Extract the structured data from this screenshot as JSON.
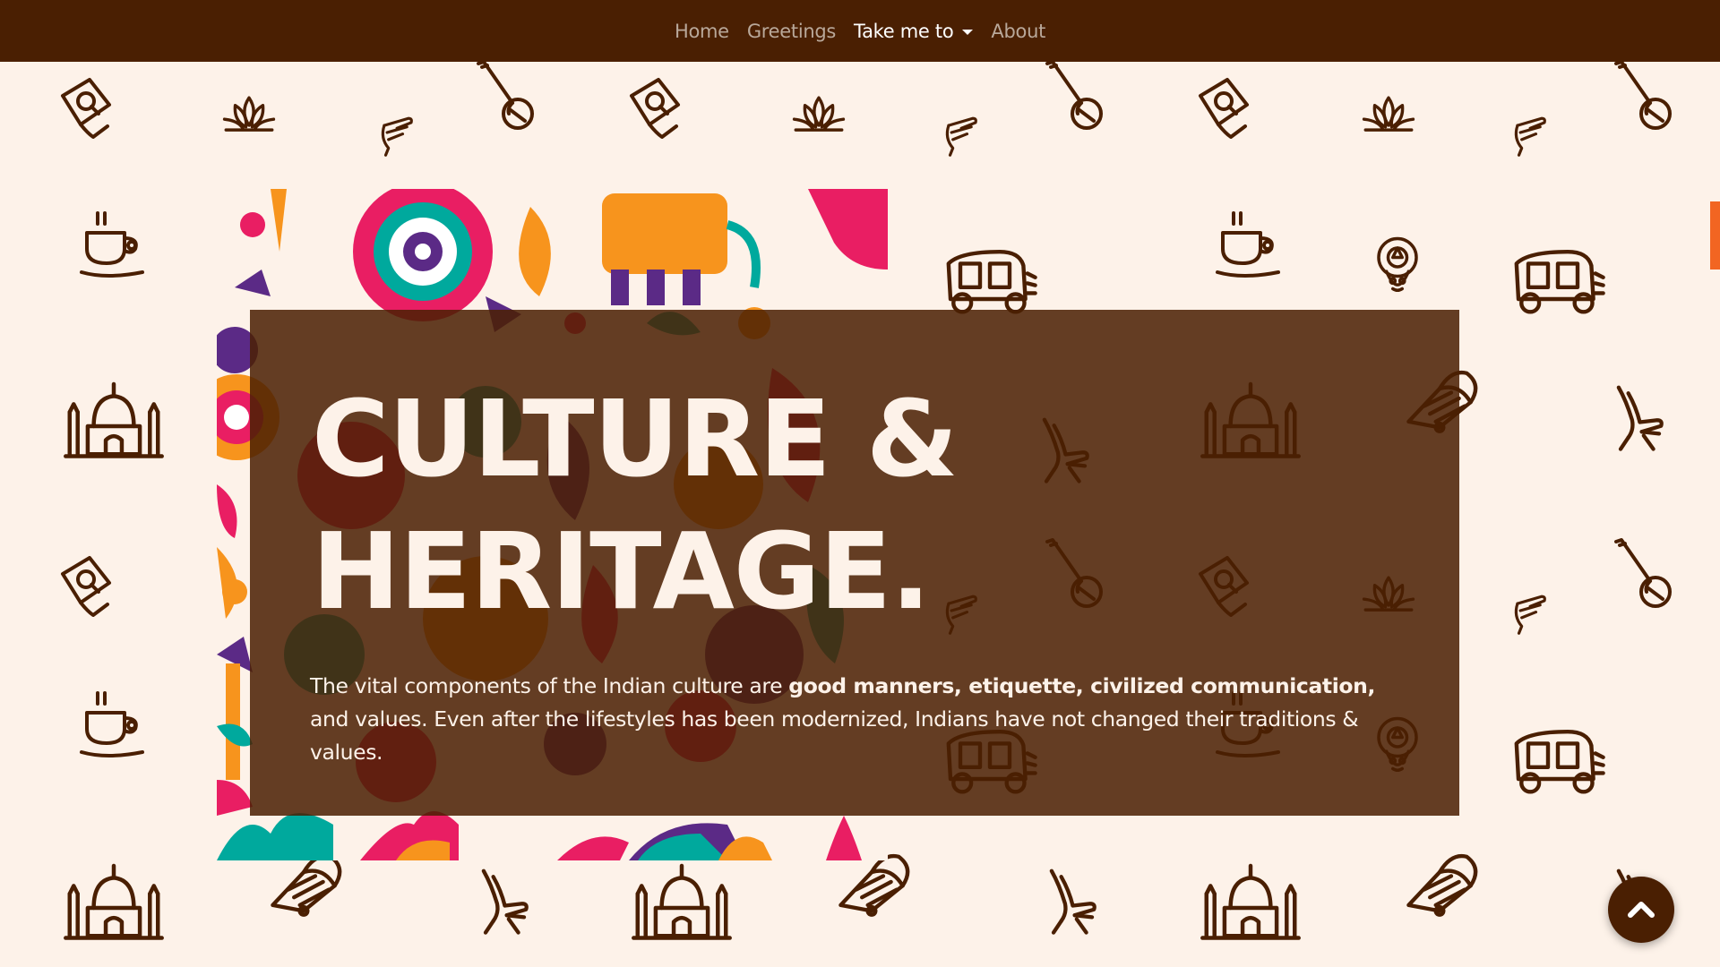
{
  "nav": {
    "items": [
      {
        "label": "Home",
        "active": false
      },
      {
        "label": "Greetings",
        "active": false
      },
      {
        "label": "Take me to",
        "active": true,
        "dropdown": true
      },
      {
        "label": "About",
        "active": false
      }
    ]
  },
  "hero": {
    "title_line1": "CULTURE &",
    "title_line2": "HERITAGE.",
    "text_before": "The vital components of the Indian culture are",
    "text_bold": "good manners, etiquette, civilized communication,",
    "text_after": "and values. Even after the lifestyles has been modernized, Indians have not changed their traditions & values."
  },
  "scroll_top": {
    "icon": "chevron-up-icon"
  },
  "colors": {
    "nav_bg": "#4a1f02",
    "page_bg": "#fdf2e9",
    "hero_overlay": "#4a1f02",
    "accent": "#f26522"
  },
  "pattern_icons": [
    "kite-icon",
    "lotus-icon",
    "sitar-icon",
    "dance-hand-icon",
    "tea-cup-icon",
    "auto-rickshaw-icon",
    "kathakali-icon",
    "taj-mahal-icon",
    "namaste-icon",
    "fan-icon"
  ]
}
